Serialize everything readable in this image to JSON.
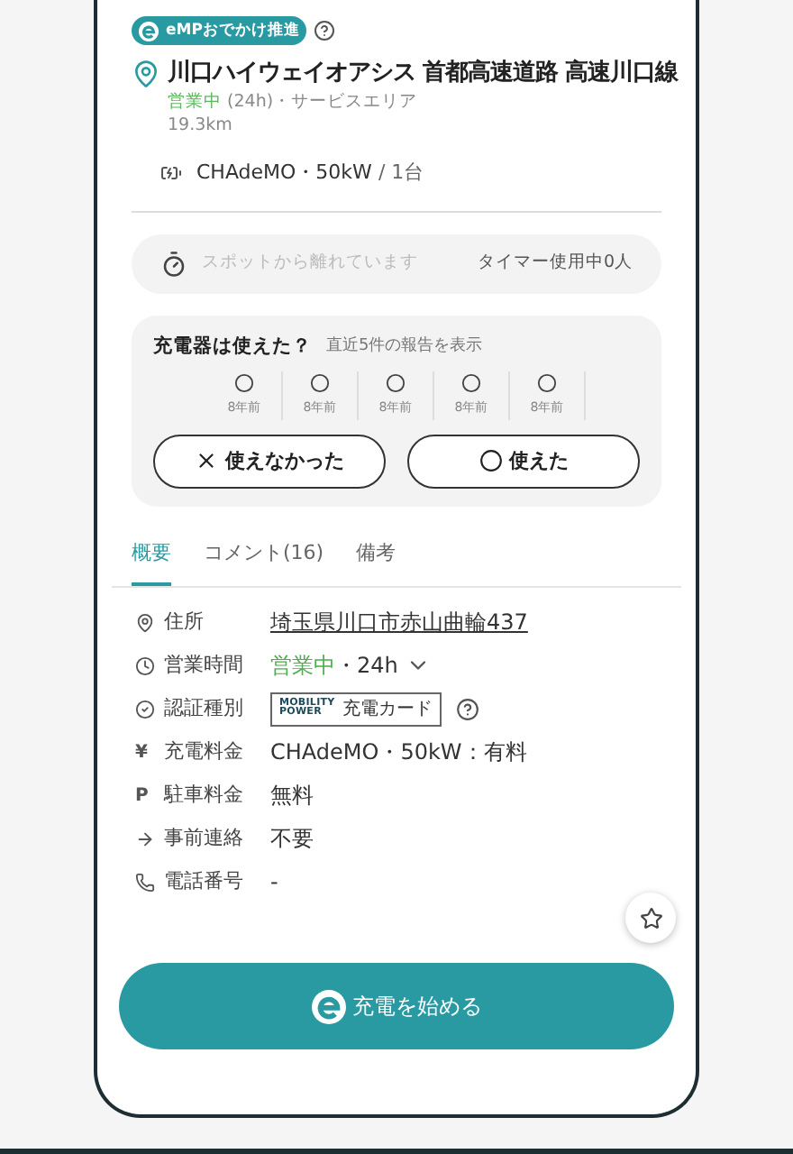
{
  "badge": {
    "label": "eMPおでかけ推進"
  },
  "spot": {
    "name": "川口ハイウェイオアシス 首都高速道路 高速川口線",
    "status": "営業中",
    "hours": "(24h)・サービスエリア",
    "distance": "19.3km",
    "connector": "CHAdeMO・50kW",
    "count": "/ 1台"
  },
  "timer": {
    "message": "スポットから離れています",
    "usage": "タイマー使用中0人"
  },
  "reports": {
    "title": "充電器は使えた？",
    "subtitle": "直近5件の報告を表示",
    "items": [
      {
        "kind": "ok",
        "time": "8年前"
      },
      {
        "kind": "ok",
        "time": "8年前"
      },
      {
        "kind": "ok",
        "time": "8年前"
      },
      {
        "kind": "ok",
        "time": "8年前"
      },
      {
        "kind": "ok",
        "time": "8年前"
      }
    ],
    "buttons": [
      {
        "kind": "ng",
        "label": "使えなかった"
      },
      {
        "kind": "ok",
        "label": "使えた"
      }
    ]
  },
  "tabs": [
    {
      "label": "概要",
      "selected": true
    },
    {
      "label": "コメント(16)",
      "selected": false
    },
    {
      "label": "備考",
      "selected": false
    }
  ],
  "info": [
    {
      "label": "住所",
      "kind": "link",
      "value": "埼玉県川口市赤山曲輪437"
    },
    {
      "label": "営業時間",
      "kind": "hours",
      "status": "営業中",
      "value": "・24h"
    },
    {
      "label": "認証種別",
      "kind": "card",
      "logo_top": "MOBILITY",
      "logo_bottom": "POWER",
      "value": "充電カード"
    },
    {
      "label": "充電料金",
      "kind": "text",
      "symbol": "¥",
      "value": "CHAdeMO・50kW：有料"
    },
    {
      "label": "駐車料金",
      "kind": "text",
      "symbol": "P",
      "value": "無料"
    },
    {
      "label": "事前連絡",
      "kind": "text",
      "value": "不要"
    },
    {
      "label": "電話番号",
      "kind": "text",
      "value": "-"
    }
  ],
  "start_button": {
    "label": "充電を始める"
  }
}
